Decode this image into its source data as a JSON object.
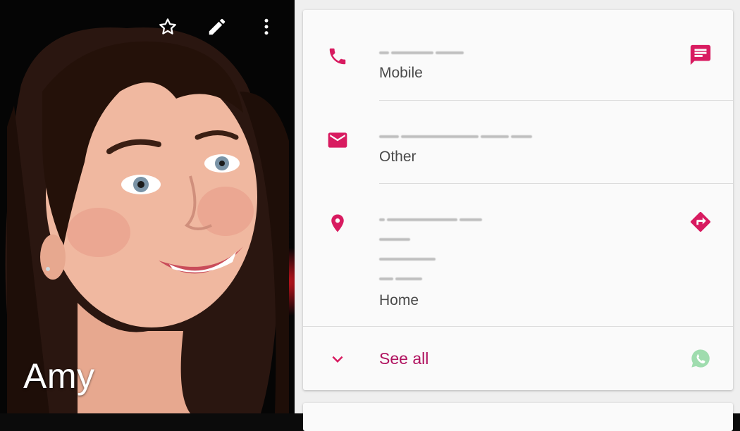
{
  "contact": {
    "name": "Amy"
  },
  "toolbar": {
    "star_icon": "star-outline-icon",
    "edit_icon": "pencil-icon",
    "more_icon": "more-vert-icon"
  },
  "details": {
    "phone": {
      "type_label": "Mobile",
      "icon": "phone-icon",
      "action_icon": "message-icon"
    },
    "email": {
      "type_label": "Other",
      "icon": "email-icon"
    },
    "address": {
      "type_label": "Home",
      "icon": "location-pin-icon",
      "action_icon": "directions-icon"
    }
  },
  "see_all": {
    "label": "See all",
    "icon": "chevron-down-icon",
    "app_icon": "whatsapp-icon"
  },
  "colors": {
    "accent": "#d81b60",
    "see_all_text": "#b0125f",
    "whatsapp": "#9fdcae"
  }
}
